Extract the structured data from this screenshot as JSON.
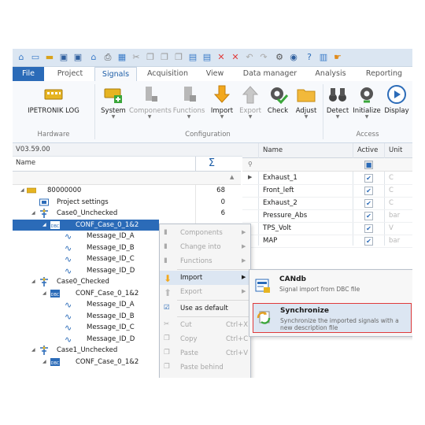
{
  "ribbon": {
    "tabs": [
      "File",
      "Project",
      "Signals",
      "Acquisition",
      "View",
      "Data manager",
      "Analysis",
      "Reporting"
    ],
    "active_tab": "Signals",
    "buttons": {
      "ipetronik_log": "IPETRONIK LOG",
      "system": "System",
      "components": "Components",
      "functions": "Functions",
      "import": "Import",
      "export": "Export",
      "check": "Check",
      "adjust": "Adjust",
      "detect": "Detect",
      "initialize": "Initialize",
      "display": "Display"
    },
    "groups": {
      "hardware": "Hardware",
      "configuration": "Configuration",
      "access": "Access"
    }
  },
  "tree": {
    "version": "V03.59.00",
    "name_header": "Name",
    "sum_symbol": "Σ",
    "rows": [
      {
        "label": "80000000",
        "count": "68"
      },
      {
        "label": "Project settings",
        "count": "0"
      },
      {
        "label": "Case0_Unchecked",
        "count": "6"
      },
      {
        "label": "CONF_Case_0_1&2",
        "count": ""
      },
      {
        "label": "Message_ID_A",
        "count": ""
      },
      {
        "label": "Message_ID_B",
        "count": ""
      },
      {
        "label": "Message_ID_C",
        "count": ""
      },
      {
        "label": "Message_ID_D",
        "count": ""
      },
      {
        "label": "Case0_Checked",
        "count": ""
      },
      {
        "label": "CONF_Case_0_1&2",
        "count": ""
      },
      {
        "label": "Message_ID_A",
        "count": ""
      },
      {
        "label": "Message_ID_B",
        "count": ""
      },
      {
        "label": "Message_ID_C",
        "count": ""
      },
      {
        "label": "Message_ID_D",
        "count": ""
      },
      {
        "label": "Case1_Unchecked",
        "count": ""
      },
      {
        "label": "CONF_Case_0_1&2",
        "count": ""
      }
    ]
  },
  "grid": {
    "headers": {
      "name": "Name",
      "active": "Active",
      "unit": "Unit"
    },
    "rows": [
      {
        "name": "Exhaust_1",
        "unit": "C"
      },
      {
        "name": "Front_left",
        "unit": "C"
      },
      {
        "name": "Exhaust_2",
        "unit": "C"
      },
      {
        "name": "Pressure_Abs",
        "unit": "bar"
      },
      {
        "name": "TPS_Volt",
        "unit": "V"
      },
      {
        "name": "MAP",
        "unit": "bar"
      }
    ]
  },
  "context_menu": {
    "items": [
      {
        "label": "Components",
        "shortcut": ""
      },
      {
        "label": "Change into",
        "shortcut": ""
      },
      {
        "label": "Functions",
        "shortcut": ""
      },
      {
        "label": "Import",
        "shortcut": ""
      },
      {
        "label": "Export",
        "shortcut": ""
      },
      {
        "label": "Use as default",
        "shortcut": ""
      },
      {
        "label": "Cut",
        "shortcut": "Ctrl+X"
      },
      {
        "label": "Copy",
        "shortcut": "Ctrl+C"
      },
      {
        "label": "Paste",
        "shortcut": "Ctrl+V"
      },
      {
        "label": "Paste behind",
        "shortcut": ""
      }
    ]
  },
  "submenu": {
    "items": [
      {
        "title": "CANdb",
        "desc": "Signal import from DBC file"
      },
      {
        "title": "Synchronize",
        "desc": "Synchronize the imported signals with a new description file"
      }
    ]
  },
  "colors": {
    "accent": "#2b6bb8",
    "highlight_border": "#e03a3a"
  }
}
